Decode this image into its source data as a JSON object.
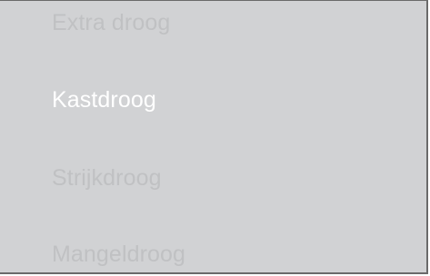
{
  "dry_program_menu": {
    "items": [
      {
        "label": "Extra droog",
        "selected": false
      },
      {
        "label": "Kastdroog",
        "selected": true
      },
      {
        "label": "Strijkdroog",
        "selected": false
      },
      {
        "label": "Mangeldroog",
        "selected": false
      }
    ],
    "colors": {
      "background": "#d1d2d4",
      "selected_text": "#ffffff",
      "unselected_text": "#c0c1c3",
      "frame": "#6a6a6a"
    }
  }
}
